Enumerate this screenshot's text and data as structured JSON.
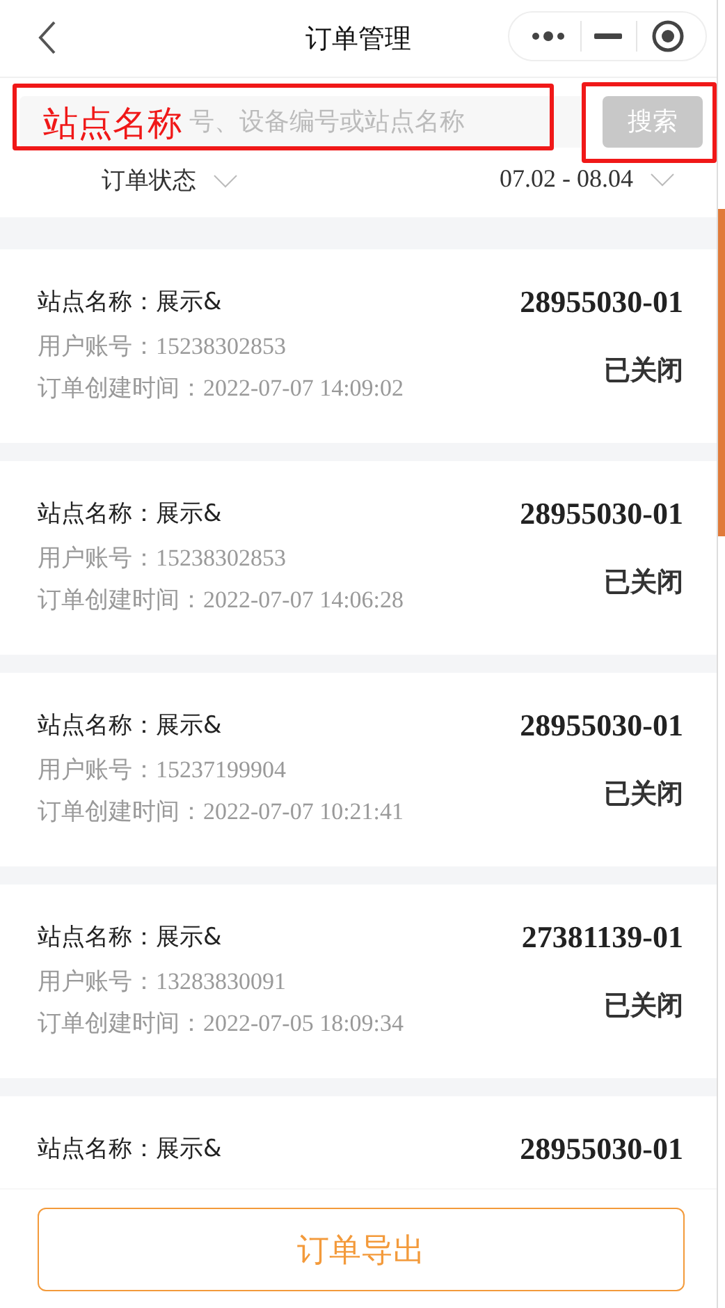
{
  "header": {
    "title": "订单管理"
  },
  "search": {
    "placeholder": "号、设备编号或站点名称",
    "button": "搜索"
  },
  "annotation": {
    "label": "站点名称"
  },
  "filters": [
    {
      "label": "订单状态"
    },
    {
      "label": "07.02 - 08.04"
    }
  ],
  "orders": [
    {
      "station_label": "站点名称：",
      "station": "展示&",
      "order_no": "28955030-01",
      "account_label": "用户账号：",
      "account": "15238302853",
      "time_label": "订单创建时间：",
      "time": "2022-07-07 14:09:02",
      "status": "已关闭"
    },
    {
      "station_label": "站点名称：",
      "station": "展示&",
      "order_no": "28955030-01",
      "account_label": "用户账号：",
      "account": "15238302853",
      "time_label": "订单创建时间：",
      "time": "2022-07-07 14:06:28",
      "status": "已关闭"
    },
    {
      "station_label": "站点名称：",
      "station": "展示&",
      "order_no": "28955030-01",
      "account_label": "用户账号：",
      "account": "15237199904",
      "time_label": "订单创建时间：",
      "time": "2022-07-07 10:21:41",
      "status": "已关闭"
    },
    {
      "station_label": "站点名称：",
      "station": "展示&",
      "order_no": "27381139-01",
      "account_label": "用户账号：",
      "account": "13283830091",
      "time_label": "订单创建时间：",
      "time": "2022-07-05 18:09:34",
      "status": "已关闭"
    },
    {
      "station_label": "站点名称：",
      "station": "展示&",
      "order_no": "28955030-01"
    }
  ],
  "export_button": "订单导出"
}
